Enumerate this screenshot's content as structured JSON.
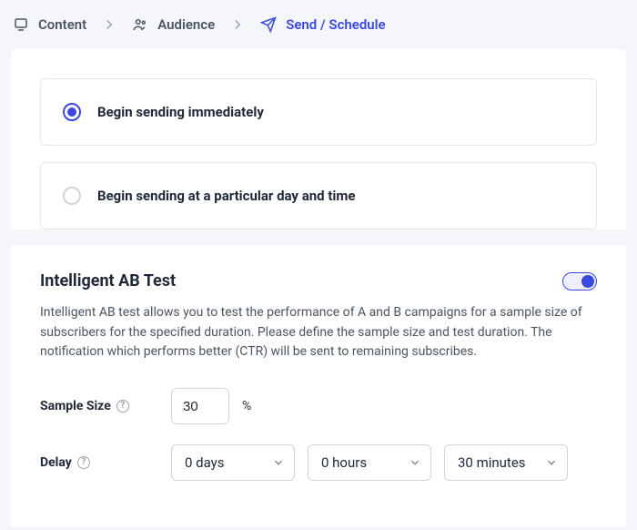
{
  "breadcrumb": {
    "content": "Content",
    "audience": "Audience",
    "send": "Send / Schedule"
  },
  "options": {
    "immediate": "Begin sending immediately",
    "scheduled": "Begin sending at a particular day and time"
  },
  "abtest": {
    "title": "Intelligent AB Test",
    "description": "Intelligent AB test allows you to test the performance of A and B campaigns for a sample size of subscribers for the specified duration. Please define the sample size and test duration. The notification which performs better (CTR) will be sent to remaining subscribes.",
    "sample_label": "Sample Size",
    "sample_value": "30",
    "sample_unit": "%",
    "delay_label": "Delay",
    "delay_days": "0 days",
    "delay_hours": "0 hours",
    "delay_minutes": "30 minutes"
  }
}
